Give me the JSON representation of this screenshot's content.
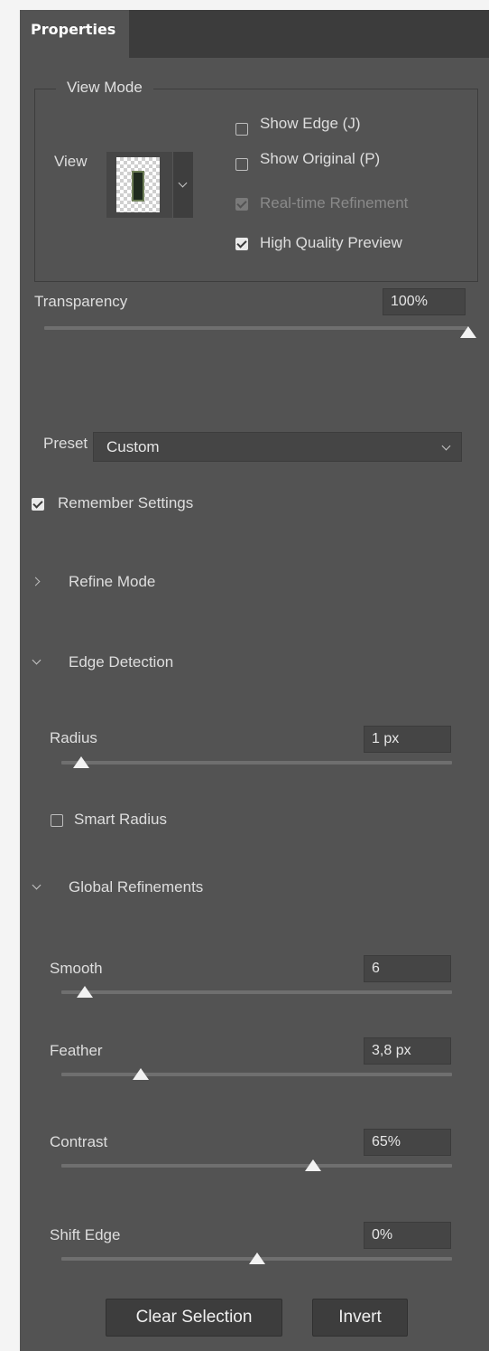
{
  "tabs": {
    "active": "Properties"
  },
  "view_mode": {
    "legend": "View Mode",
    "view_label": "View",
    "options": [
      {
        "label": "Show Edge (J)",
        "checked": false,
        "enabled": true
      },
      {
        "label": "Show Original (P)",
        "checked": false,
        "enabled": true
      },
      {
        "label": "Real-time Refinement",
        "checked": true,
        "enabled": false
      },
      {
        "label": "High Quality Preview",
        "checked": true,
        "enabled": true
      }
    ]
  },
  "transparency": {
    "label": "Transparency",
    "value": "100%",
    "fraction": 1.0
  },
  "preset": {
    "label": "Preset",
    "value": "Custom"
  },
  "remember": {
    "label": "Remember Settings",
    "checked": true
  },
  "sections": {
    "refine_mode": {
      "label": "Refine Mode",
      "expanded": false
    },
    "edge_detection": {
      "label": "Edge Detection",
      "expanded": true
    },
    "global_refinements": {
      "label": "Global Refinements",
      "expanded": true
    }
  },
  "radius": {
    "label": "Radius",
    "value": "1 px",
    "fraction": 0.05
  },
  "smart_radius": {
    "label": "Smart Radius",
    "checked": false
  },
  "smooth": {
    "label": "Smooth",
    "value": "6",
    "fraction": 0.06
  },
  "feather": {
    "label": "Feather",
    "value": "3,8 px",
    "fraction": 0.2
  },
  "contrast": {
    "label": "Contrast",
    "value": "65%",
    "fraction": 0.65
  },
  "shift_edge": {
    "label": "Shift Edge",
    "value": "0%",
    "fraction": 0.5
  },
  "buttons": {
    "clear_selection": "Clear Selection",
    "invert": "Invert"
  },
  "colors": {
    "panel_bg": "#535353",
    "tab_bar_bg": "#3c3c3c",
    "field_bg": "#454545"
  }
}
